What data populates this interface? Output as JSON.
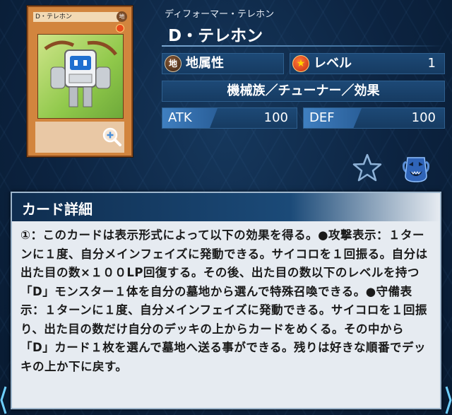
{
  "card": {
    "thumbnail_name": "D・テレホン",
    "thumbnail_attribute": "地",
    "zoom_icon": "magnifier-plus-icon"
  },
  "header": {
    "reading": "ディフォーマー・テレホン",
    "name": "D・テレホン"
  },
  "stats": {
    "attribute_icon_text": "地",
    "attribute": "地属性",
    "level_label": "レベル",
    "level": "1",
    "types": "機械族／チューナー／効果",
    "atk_label": "ATK",
    "atk": "100",
    "def_label": "DEF",
    "def": "100"
  },
  "icons": {
    "favorite": "star-outline-icon",
    "deck": "deck-pot-icon"
  },
  "detail": {
    "title": "カード詳細",
    "text": "①：このカードは表示形式によって以下の効果を得る。●攻撃表示：１ターンに１度、自分メインフェイズに発動できる。サイコロを１回振る。自分は出た目の数×１００LP回復する。その後、出た目の数以下のレベルを持つ「D」モンスター１体を自分の墓地から選んで特殊召喚できる。●守備表示：１ターンに１度、自分メインフェイズに発動できる。サイコロを１回振り、出た目の数だけ自分のデッキの上からカードをめくる。その中から「D」カード１枚を選んで墓地へ送る事ができる。残りは好きな順番でデッキの上か下に戻す。"
  },
  "colors": {
    "background": "#0c2340",
    "stat_bar": "#1d4976",
    "detail_bg": "#e6ebf1",
    "accent": "#3f7fc0"
  }
}
